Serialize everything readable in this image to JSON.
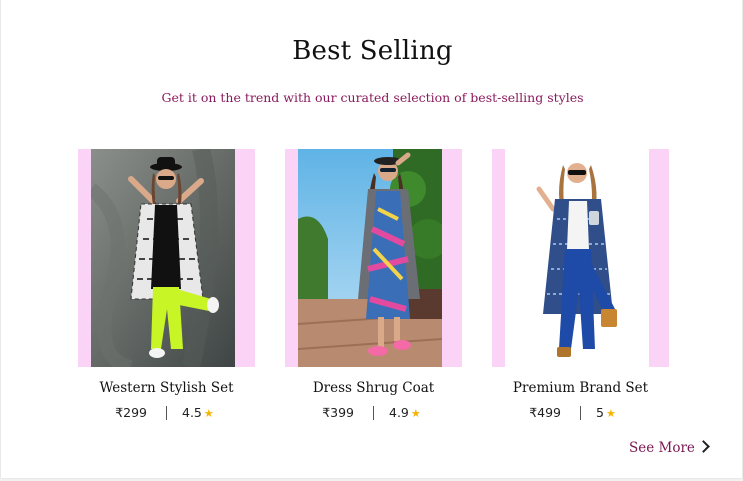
{
  "section": {
    "title": "Best Selling",
    "subtitle": "Get it on the trend with our curated selection of best-selling styles"
  },
  "products": [
    {
      "name": "Western Stylish Set",
      "price": "₹299",
      "rating": "4.5"
    },
    {
      "name": "Dress Shrug Coat",
      "price": "₹399",
      "rating": "4.9"
    },
    {
      "name": "Premium Brand Set",
      "price": "₹499",
      "rating": "5"
    }
  ],
  "see_more": {
    "label": "See More"
  },
  "colors": {
    "accent": "#8a1a5c",
    "card_background": "#fbd3f6",
    "star": "#f5b400"
  },
  "icons": {
    "star": "star-icon",
    "chevron": "chevron-right-icon"
  }
}
